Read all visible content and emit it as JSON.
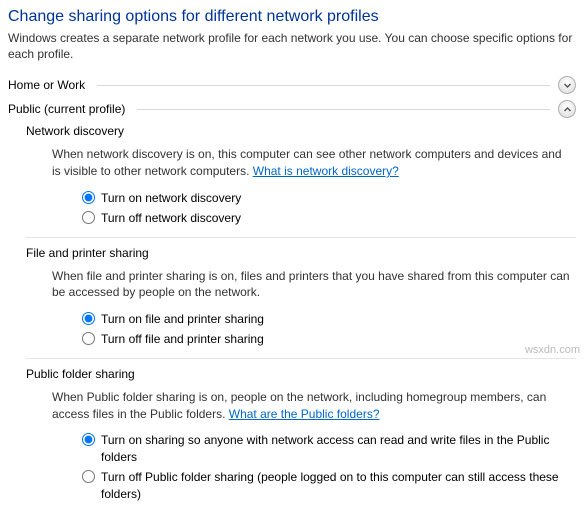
{
  "page": {
    "title": "Change sharing options for different network profiles",
    "description": "Windows creates a separate network profile for each network you use. You can choose specific options for each profile."
  },
  "profiles": {
    "homework": {
      "label": "Home or Work",
      "expanded": false
    },
    "public": {
      "label": "Public (current profile)",
      "expanded": true
    }
  },
  "sections": {
    "network_discovery": {
      "title": "Network discovery",
      "desc_prefix": "When network discovery is on, this computer can see other network computers and devices and is visible to other network computers. ",
      "link": "What is network discovery?",
      "options": {
        "on": "Turn on network discovery",
        "off": "Turn off network discovery"
      },
      "selected": "on"
    },
    "file_printer": {
      "title": "File and printer sharing",
      "desc": "When file and printer sharing is on, files and printers that you have shared from this computer can be accessed by people on the network.",
      "options": {
        "on": "Turn on file and printer sharing",
        "off": "Turn off file and printer sharing"
      },
      "selected": "on"
    },
    "public_folder": {
      "title": "Public folder sharing",
      "desc_prefix": "When Public folder sharing is on, people on the network, including homegroup members, can access files in the Public folders. ",
      "link": "What are the Public folders?",
      "options": {
        "on": "Turn on sharing so anyone with network access can read and write files in the Public folders",
        "off": "Turn off Public folder sharing (people logged on to this computer can still access these folders)"
      },
      "selected": "on"
    }
  },
  "watermark": "wsxdn.com"
}
